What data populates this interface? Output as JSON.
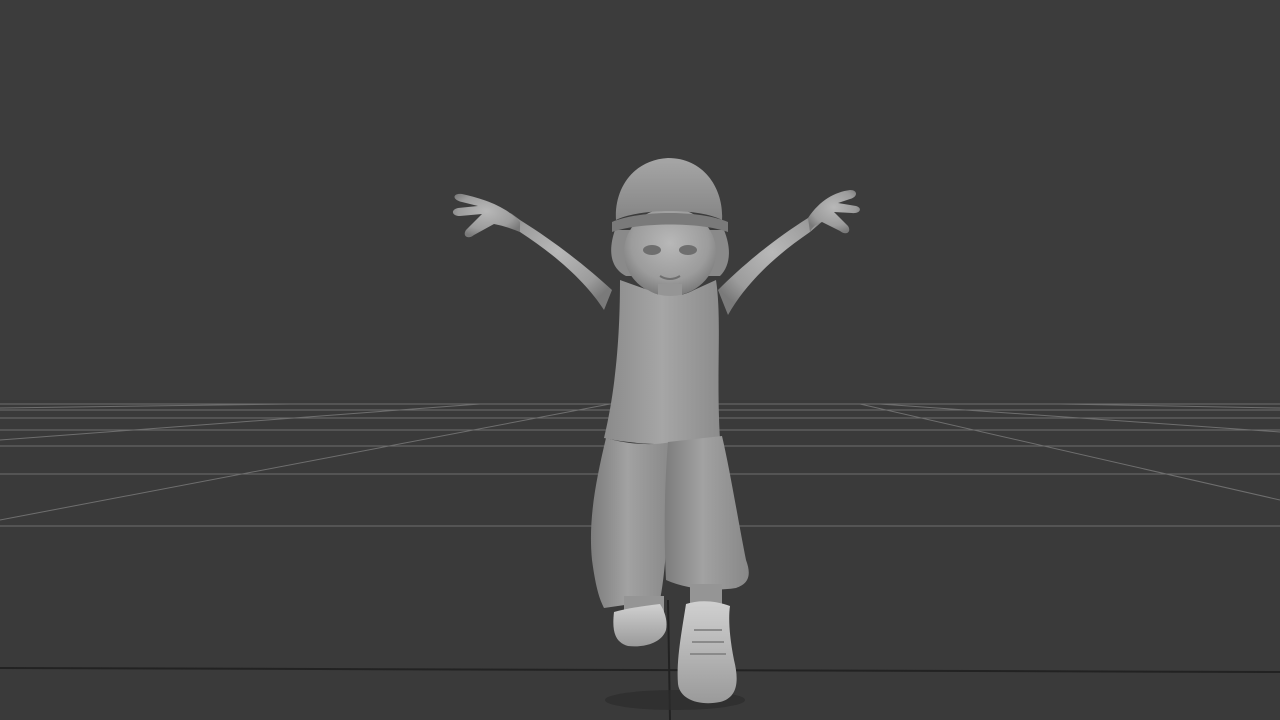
{
  "viewport": {
    "background_color": "#3c3c3c",
    "ground_color": "#3a3a3a",
    "grid_color": "#9a9a9a",
    "grid_axis_color": "#222222",
    "shading": "default-shaded",
    "model_color": "#a8a8a8",
    "subject": "animated-cartoon-girl-character"
  }
}
